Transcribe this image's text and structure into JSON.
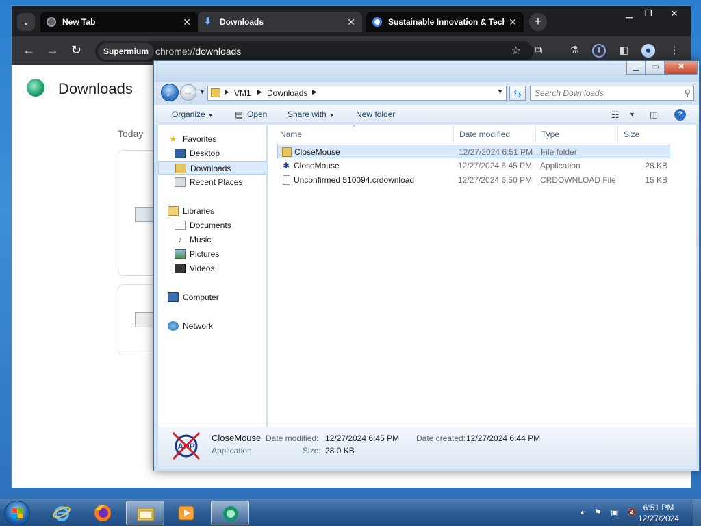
{
  "browser": {
    "tabs": [
      {
        "title": "New Tab"
      },
      {
        "title": "Downloads"
      },
      {
        "title": "Sustainable Innovation & Technology"
      }
    ],
    "omnibox_chip": "Supermium",
    "url_scheme": "chrome://",
    "url_path": "downloads",
    "page_title": "Downloads",
    "section_label": "Today"
  },
  "explorer": {
    "breadcrumb": [
      "VM1",
      "Downloads"
    ],
    "search_placeholder": "Search Downloads",
    "commands": {
      "organize": "Organize",
      "open": "Open",
      "share_with": "Share with",
      "new_folder": "New folder"
    },
    "nav": {
      "favorites": "Favorites",
      "desktop": "Desktop",
      "downloads": "Downloads",
      "recent": "Recent Places",
      "libraries": "Libraries",
      "documents": "Documents",
      "music": "Music",
      "pictures": "Pictures",
      "videos": "Videos",
      "computer": "Computer",
      "network": "Network"
    },
    "columns": {
      "name": "Name",
      "date": "Date modified",
      "type": "Type",
      "size": "Size"
    },
    "files": [
      {
        "name": "CloseMouse",
        "date": "12/27/2024 6:51 PM",
        "type": "File folder",
        "size": ""
      },
      {
        "name": "CloseMouse",
        "date": "12/27/2024 6:45 PM",
        "type": "Application",
        "size": "28 KB"
      },
      {
        "name": "Unconfirmed 510094.crdownload",
        "date": "12/27/2024 6:50 PM",
        "type": "CRDOWNLOAD File",
        "size": "15 KB"
      }
    ],
    "details": {
      "name": "CloseMouse",
      "kind": "Application",
      "modified_label": "Date modified:",
      "modified_value": "12/27/2024 6:45 PM",
      "created_label": "Date created:",
      "created_value": "12/27/2024 6:44 PM",
      "size_label": "Size:",
      "size_value": "28.0 KB",
      "icon_text": "AHP"
    }
  },
  "taskbar": {
    "time": "6:51 PM",
    "date": "12/27/2024"
  },
  "colors": {
    "chrome_dark": "#35363a",
    "explorer_selection": "#d9e9fb",
    "taskbar": "#2b5d95"
  }
}
